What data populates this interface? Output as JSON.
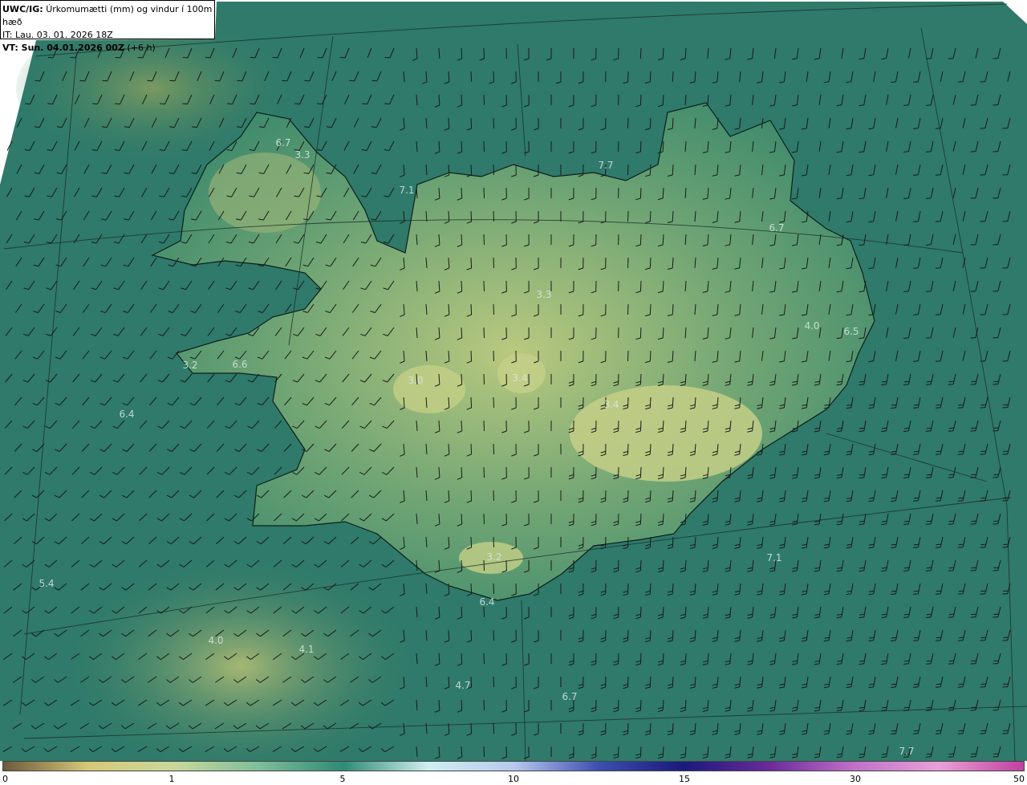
{
  "header": {
    "model": "UWC/IG:",
    "title": "Úrkomumætti (mm) og vindur í 100m hæð",
    "init_time": "IT: Lau. 03. 01. 2026 18Z",
    "valid_prefix": "VT: Sun. 04.01.2026 00Z",
    "valid_suffix": "(+6 h)"
  },
  "value_labels": [
    "6.7",
    "3.3",
    "7.7",
    "7.1",
    "6.7",
    "3.3",
    "4.0",
    "6.5",
    "3.2",
    "6.6",
    "3.0",
    "3.4",
    "3.4",
    "6.4",
    "3.2",
    "7.1",
    "5.4",
    "6.4",
    "4.0",
    "4.1",
    "4.7",
    "6.7",
    "7.7"
  ],
  "colorbar": {
    "ticks": [
      "0",
      "1",
      "5",
      "10",
      "15",
      "30",
      "50"
    ],
    "colors": [
      "#6b5a3c",
      "#d6c878",
      "#c9d89a",
      "#7fbf9a",
      "#2f8a76",
      "#cfeff0",
      "#b8c8ee",
      "#3d4fb0",
      "#1a1a7a",
      "#6a2a9a",
      "#c070c8",
      "#e8a0d8",
      "#c040a0"
    ]
  },
  "colors": {
    "sea": "#2f7a6a",
    "land_low": "#3f8f6e",
    "land_high": "#c8d48a",
    "barb": "#1a1a1a"
  }
}
